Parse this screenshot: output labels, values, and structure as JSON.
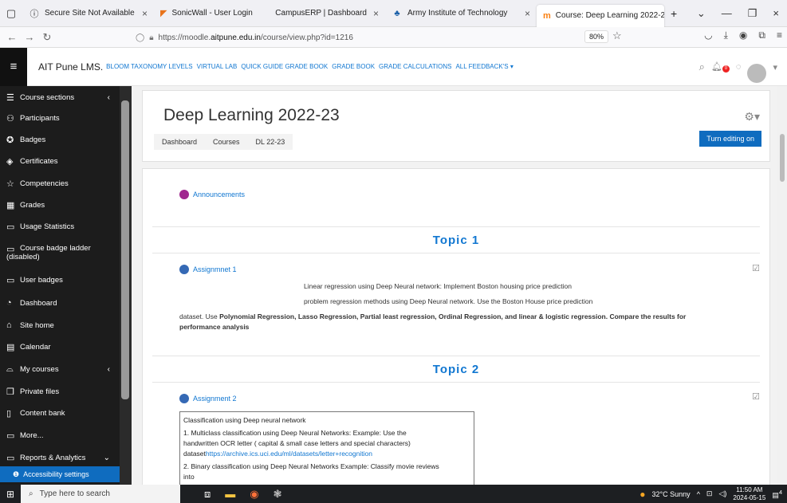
{
  "browser": {
    "tabs": [
      {
        "title": "Secure Site Not Available",
        "icon": "info-icon"
      },
      {
        "title": "SonicWall - User Login",
        "icon": "sonicwall-icon"
      },
      {
        "title": "CampusERP | Dashboard",
        "icon": "blank-icon"
      },
      {
        "title": "Army Institute of Technology",
        "icon": "ait-logo-icon"
      },
      {
        "title": "Course: Deep Learning 2022-23",
        "icon": "moodle-icon",
        "active": true
      }
    ],
    "url_prefix": "https://moodle.",
    "url_host": "aitpune.edu.in",
    "url_path": "/course/view.php?id=1216",
    "zoom": "80%"
  },
  "topnav": {
    "brand": "AIT Pune LMS.",
    "menu": [
      "BLOOM TAXONOMY LEVELS",
      "VIRTUAL LAB",
      "QUICK GUIDE GRADE BOOK",
      "GRADE BOOK",
      "GRADE CALCULATIONS",
      "ALL FEEDBACK'S ▾"
    ],
    "notif_count": "0"
  },
  "drawer": {
    "items": [
      {
        "label": "Course sections",
        "icon": "list-icon",
        "chevron": true
      },
      {
        "label": "Participants",
        "icon": "people-icon"
      },
      {
        "label": "Badges",
        "icon": "badge-icon"
      },
      {
        "label": "Certificates",
        "icon": "certificate-icon"
      },
      {
        "label": "Competencies",
        "icon": "star-icon"
      },
      {
        "label": "Grades",
        "icon": "table-icon"
      },
      {
        "label": "Usage Statistics",
        "icon": "folder-icon"
      },
      {
        "label": "Course badge ladder",
        "label2": "(disabled)",
        "icon": "folder-icon"
      },
      {
        "label": "User badges",
        "icon": "folder-icon"
      },
      {
        "label": "Dashboard",
        "icon": "gauge-icon"
      },
      {
        "label": "Site home",
        "icon": "home-icon"
      },
      {
        "label": "Calendar",
        "icon": "calendar-icon"
      },
      {
        "label": "My courses",
        "icon": "graduation-icon",
        "chevron": true
      },
      {
        "label": "Private files",
        "icon": "files-icon"
      },
      {
        "label": "Content bank",
        "icon": "content-icon"
      },
      {
        "label": "More...",
        "icon": "folder-icon"
      },
      {
        "label": "Reports & Analytics",
        "icon": "folder-icon",
        "chevron": true
      }
    ],
    "accessibility": "Accessibility settings"
  },
  "course": {
    "title": "Deep Learning 2022-23",
    "breadcrumb": [
      "Dashboard",
      "Courses",
      "DL 22-23"
    ],
    "edit_button": "Turn editing on",
    "announcements": "Announcements",
    "topic1": "Topic 1",
    "assignment1": {
      "name": "Assignmnet 1",
      "line1": "Linear regression using Deep Neural network: Implement Boston housing price prediction",
      "line2": "problem regression methods using Deep Neural network. Use the Boston House price prediction",
      "line3_prefix": "dataset. Use ",
      "line3_bold": "Polynomial Regression, Lasso Regression, Partial least regression, Ordinal Regression, and linear & logistic regression. Compare the results for",
      "line4_bold": "performance analysis"
    },
    "topic2": "Topic 2",
    "assignment2": {
      "name": "Assignment 2",
      "heading": "Classification using Deep neural network",
      "item1a": "1. Multiclass classification using Deep Neural Networks: Example: Use the",
      "item1b": "handwritten  OCR letter ( capital  & small case letters  and special characters)",
      "item1c_prefix": "dataset",
      "item1c_link": "https://archive.ics.uci.edu/ml/datasets/letter+recognition",
      "item2a": "2. Binary classification using Deep Neural Networks Example: Classify movie reviews",
      "item2b": "into"
    }
  },
  "taskbar": {
    "search": "Type here to search",
    "weather": "32°C  Sunny",
    "time": "11:50 AM",
    "date": "2024-05-15",
    "notif": "4"
  }
}
